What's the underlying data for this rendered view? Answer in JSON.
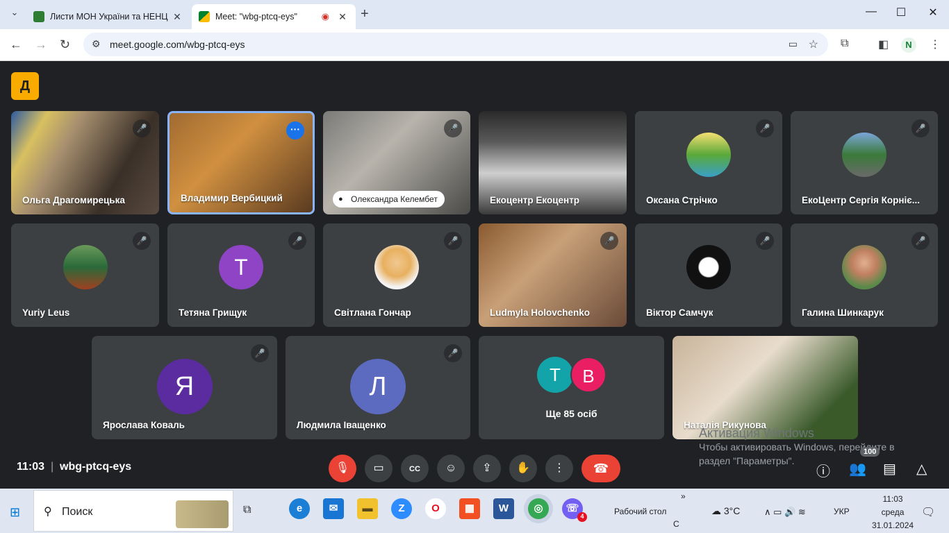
{
  "browser": {
    "tabs": [
      {
        "title": "Листи МОН України та НЕНЦ |",
        "favicon_color": "#2e7d32"
      },
      {
        "title": "Meet: \"wbg-ptcq-eys\"",
        "favicon_color": "#00832d"
      }
    ],
    "url": "meet.google.com/wbg-ptcq-eys",
    "profile_initial": "N"
  },
  "meet": {
    "logo_glyph": "Д",
    "participants_row1": [
      {
        "name": "Ольга Драгомирецька",
        "kind": "video"
      },
      {
        "name": "Владимир Вербицкий",
        "kind": "video",
        "active": true
      },
      {
        "name": "Олександра Келембет",
        "kind": "video",
        "pinned_label": true
      },
      {
        "name": "Екоцентр Екоцентр",
        "kind": "video"
      },
      {
        "name": "Оксана Стрічко",
        "kind": "avatar"
      },
      {
        "name": "ЕкоЦентр Сергія Корніє...",
        "kind": "avatar"
      }
    ],
    "participants_row2": [
      {
        "name": "Yuriy Leus",
        "kind": "avatar"
      },
      {
        "name": "Тетяна Грищук",
        "kind": "letter",
        "letter": "Т",
        "color": "#8e44c4"
      },
      {
        "name": "Світлана Гончар",
        "kind": "avatar"
      },
      {
        "name": "Ludmyla Holovchenko",
        "kind": "video"
      },
      {
        "name": "Віктор Самчук",
        "kind": "avatar"
      },
      {
        "name": "Галина Шинкарук",
        "kind": "avatar"
      }
    ],
    "participants_row3": [
      {
        "name": "Ярослава Коваль",
        "kind": "letter",
        "letter": "Я",
        "color": "#5b2ca0"
      },
      {
        "name": "Людмила Іващенко",
        "kind": "letter",
        "letter": "Л",
        "color": "#5c6bc0"
      },
      {
        "name": "Наталія Рикунова",
        "kind": "video"
      }
    ],
    "others": {
      "label": "Ще 85 осіб",
      "letters": [
        "Т",
        "В"
      ],
      "colors": [
        "#12a4a8",
        "#e91e63"
      ]
    },
    "time": "11:03",
    "meeting_code": "wbg-ptcq-eys",
    "participant_count": "100",
    "activation": {
      "heading": "Активация Windows",
      "line1": "Чтобы активировать Windows, перейдите в",
      "line2": "раздел \"Параметры\"."
    }
  },
  "taskbar": {
    "search_label": "Поиск",
    "desktop_label": "Рабочий стол",
    "desktop_c": "С",
    "weather": "3°C",
    "lang": "УКР",
    "time": "11:03",
    "day": "среда",
    "date": "31.01.2024",
    "viber_badge": "4"
  }
}
